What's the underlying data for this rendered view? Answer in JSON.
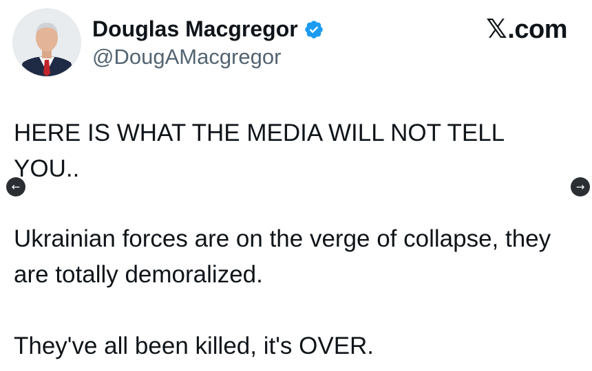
{
  "header": {
    "display_name": "Douglas Macgregor",
    "handle": "@DougAMacgregor",
    "verified_icon": "verified-badge-icon",
    "brand_mark": "𝕏",
    "brand_suffix": ".com"
  },
  "tweet": {
    "paragraphs": [
      "HERE IS WHAT THE MEDIA WILL NOT TELL YOU..",
      "Ukrainian forces are on the verge of collapse, they are totally demoralized.",
      "They've all been killed, it's OVER."
    ]
  },
  "controls": {
    "prev_arrow": "←",
    "next_arrow": "→"
  },
  "colors": {
    "verified_blue": "#1d9bf0",
    "text": "#0f1419",
    "handle_gray": "#536471",
    "arrow_bg": "#2b2f33"
  }
}
